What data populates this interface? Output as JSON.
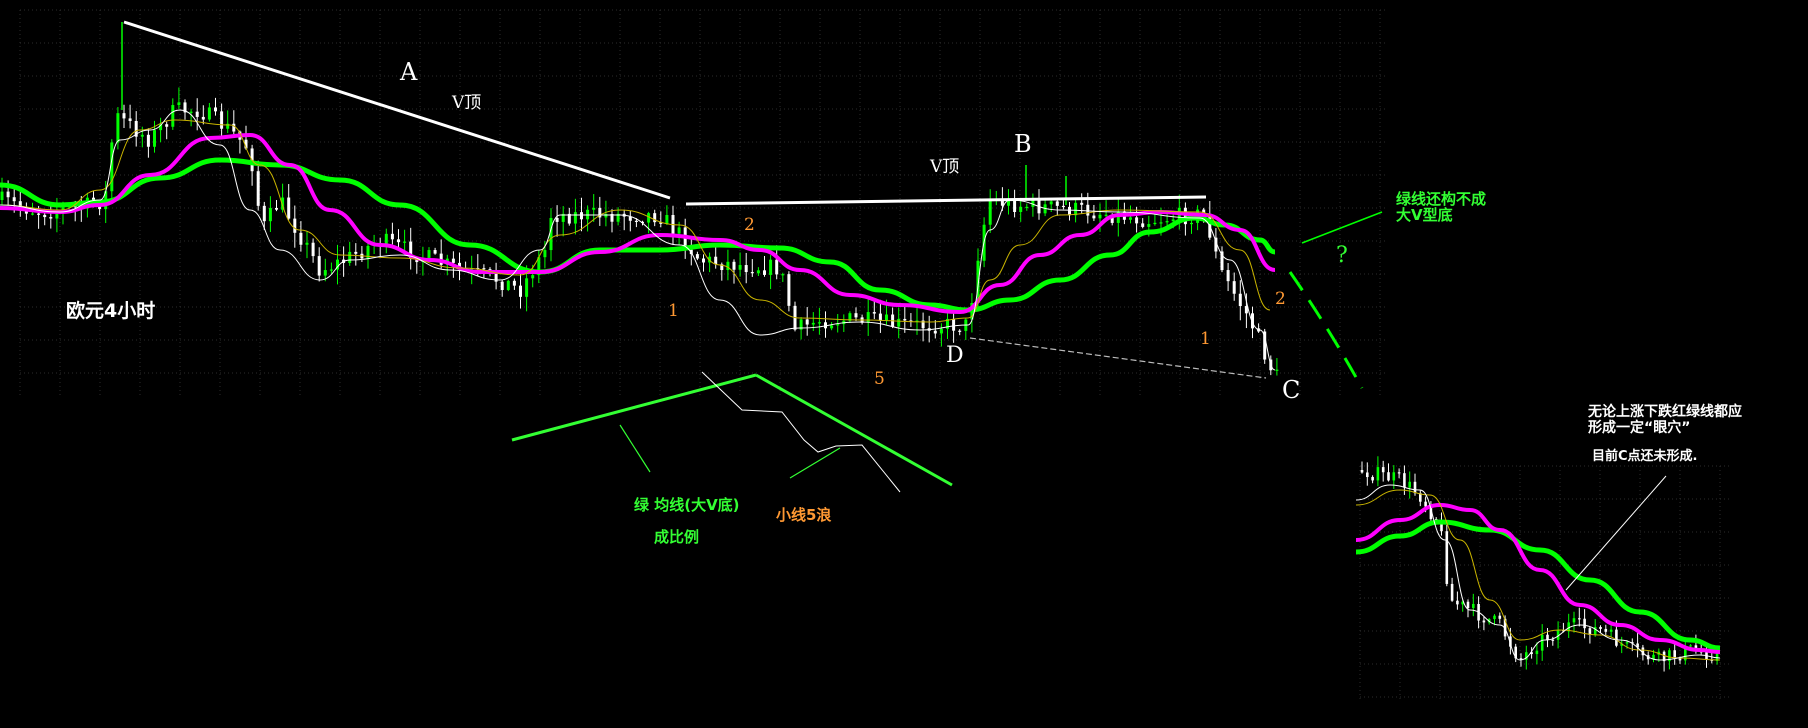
{
  "chart_data": [
    {
      "type": "candlestick",
      "title": "欧元4小时",
      "grid": true,
      "series": [
        {
          "name": "",
          "color": "#00ff00",
          "role": "long moving average"
        },
        {
          "name": "",
          "color": "#ff00ff",
          "role": "medium moving average"
        },
        {
          "name": "",
          "color": "#c9b400",
          "role": "short moving average"
        },
        {
          "name": "",
          "color": "#ffffff",
          "role": "fast moving average"
        }
      ],
      "annotations": {
        "point_a": "A",
        "point_b": "B",
        "point_c": "C",
        "point_d": "D",
        "v_top_1": "V顶",
        "v_top_2": "V顶",
        "wave_1a": "1",
        "wave_2a": "2",
        "wave_5": "5",
        "wave_1b": "1",
        "wave_2b": "2",
        "question": "?",
        "green_note_line1": "绿线还构不成",
        "green_note_line2": "大V型底",
        "green_ma_note": "绿 均线(大V底)",
        "proportion_note": "成比例",
        "small_wave_note": "小线5浪"
      },
      "colors": {
        "bull_candle": "#00ff00",
        "bear_candle": "#ffffff",
        "annotation_white": "#ffffff",
        "annotation_orange": "#ff9933",
        "annotation_green": "#33ff33"
      }
    },
    {
      "type": "candlestick",
      "title": "",
      "grid": true,
      "annotations": {
        "note_line1": "无论上涨下跌红绿线都应",
        "note_line2": "形成一定“眼穴”",
        "note_line3": "目前C点还未形成."
      }
    }
  ]
}
